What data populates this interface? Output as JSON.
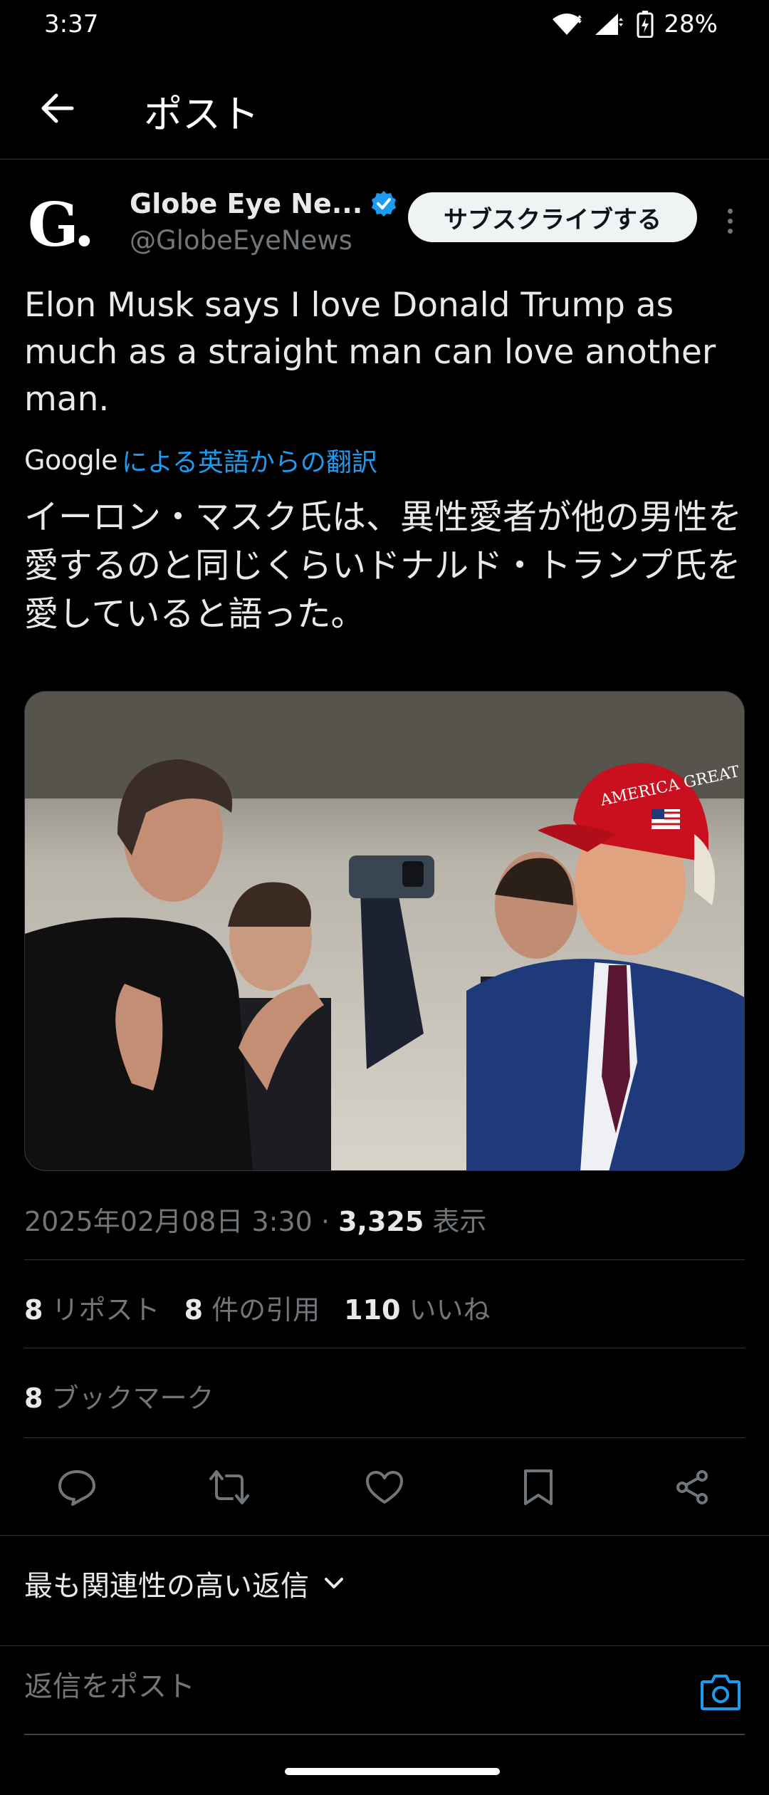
{
  "status_bar": {
    "time": "3:37",
    "battery": "28%"
  },
  "header": {
    "title": "ポスト"
  },
  "author": {
    "avatar_letter": "G.",
    "name": "Globe Eye Ne...",
    "handle": "@GlobeEyeNews",
    "subscribe_label": "サブスクライブする"
  },
  "post": {
    "text": "Elon Musk says I love Donald Trump as much as a straight man can love another man.",
    "translation_provider": "Google",
    "translation_label": "による英語からの翻訳",
    "translated_text": "イーロン・マスク氏は、異性愛者が他の男性を愛するのと同じくらいドナルド・トランプ氏を愛していると語った。",
    "image_hat_text": "AMERICA GREAT AGAIN"
  },
  "meta": {
    "datetime": "2025年02月08日 3:30",
    "separator": "·",
    "views_count": "3,325",
    "views_label": "表示"
  },
  "stats": {
    "reposts_count": "8",
    "reposts_label": "リポスト",
    "quotes_count": "8",
    "quotes_label": "件の引用",
    "likes_count": "110",
    "likes_label": "いいね",
    "bookmarks_count": "8",
    "bookmarks_label": "ブックマーク"
  },
  "actions": [
    "reply-icon",
    "repost-icon",
    "like-icon",
    "bookmark-icon",
    "share-icon"
  ],
  "replies": {
    "sort_label": "最も関連性の高い返信",
    "input_placeholder": "返信をポスト"
  },
  "colors": {
    "accent": "#1d9bf0",
    "background": "#000000",
    "muted": "#71767b"
  }
}
